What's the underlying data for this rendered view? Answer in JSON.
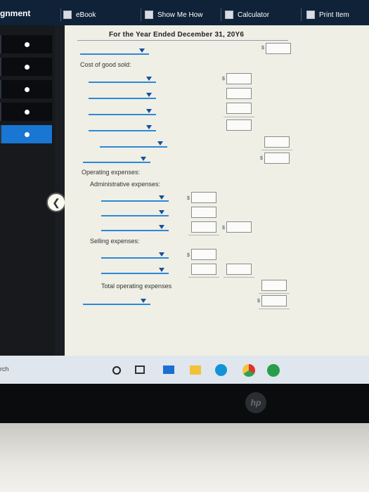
{
  "header": {
    "title": "gnment",
    "ebook": "eBook",
    "show_me_how": "Show Me How",
    "calculator": "Calculator",
    "print_item": "Print Item"
  },
  "statement": {
    "period": "For the Year Ended December 31, 20Y6",
    "cost_of_goods_sold_label": "Cost of good sold:",
    "operating_expenses_label": "Operating expenses:",
    "administrative_expenses_label": "Administrative expenses:",
    "selling_expenses_label": "Selling expenses:",
    "total_operating_expenses_label": "Total operating expenses",
    "currency_symbol": "$"
  },
  "taskbar": {
    "search": "rch"
  },
  "laptop": {
    "brand": "hp"
  }
}
